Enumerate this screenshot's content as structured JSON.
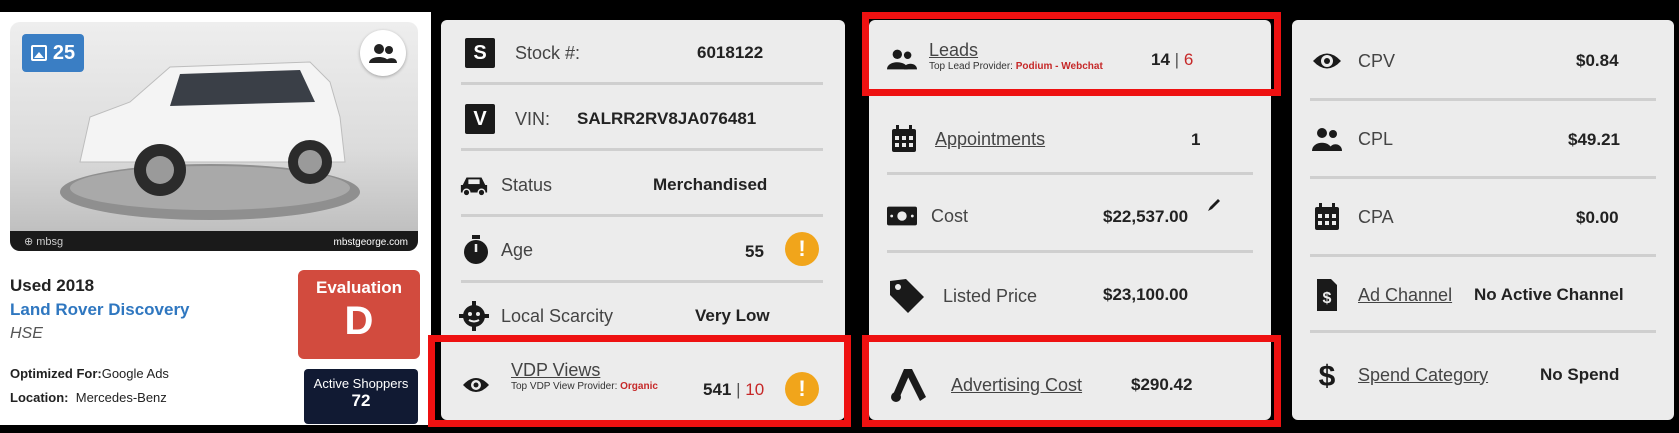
{
  "vehicle": {
    "photo_count": "25",
    "photo_watermark": "mbstgeorge.com",
    "photo_logo": "⊕ mbsg",
    "condition_year": "Used 2018",
    "name": "Land Rover Discovery",
    "trim": "HSE",
    "optimized_label": "Optimized For:",
    "optimized_value": "Google Ads",
    "location_label": "Location:",
    "location_value": "Mercedes-Benz",
    "evaluation_label": "Evaluation",
    "evaluation_grade": "D",
    "active_shoppers_label": "Active Shoppers",
    "active_shoppers_value": "72",
    "colors": {
      "name_link": "#2f77c0",
      "evaluation_bg": "#d24b3e",
      "active_bg": "#111a33",
      "photo_badge": "#3a7ec4"
    }
  },
  "details": {
    "stock_label": "Stock #:",
    "stock_value": "6018122",
    "stock_icon_letter": "S",
    "vin_label": "VIN:",
    "vin_value": "SALRR2RV8JA076481",
    "vin_icon_letter": "V",
    "status_label": "Status",
    "status_value": "Merchandised",
    "age_label": "Age",
    "age_value": "55",
    "scarcity_label": "Local Scarcity",
    "scarcity_value": "Very Low",
    "vdp_label": "VDP Views",
    "vdp_sub_label": "Top VDP View Provider:",
    "vdp_sub_value": "Organic",
    "vdp_value": "541",
    "vdp_separator": "|",
    "vdp_value_alt": "10",
    "warn_glyph": "!"
  },
  "leads": {
    "leads_label": "Leads",
    "leads_sub_label": "Top Lead Provider:",
    "leads_sub_value": "Podium - Webchat",
    "leads_value": "14",
    "leads_separator": "|",
    "leads_value_alt": "6",
    "appointments_label": "Appointments",
    "appointments_value": "1",
    "cost_label": "Cost",
    "cost_value": "$22,537.00",
    "listed_label": "Listed Price",
    "listed_value": "$23,100.00",
    "advertising_label": "Advertising Cost",
    "advertising_value": "$290.42"
  },
  "metrics": {
    "cpv_label": "CPV",
    "cpv_value": "$0.84",
    "cpl_label": "CPL",
    "cpl_value": "$49.21",
    "cpa_label": "CPA",
    "cpa_value": "$0.00",
    "channel_label": "Ad Channel",
    "channel_value": "No Active Channel",
    "spend_label": "Spend Category",
    "spend_value": "No Spend"
  },
  "colors": {
    "highlight": "#ee1111",
    "warning": "#f1a51b",
    "accent_red": "#c62828",
    "card_bg": "#ececec"
  }
}
